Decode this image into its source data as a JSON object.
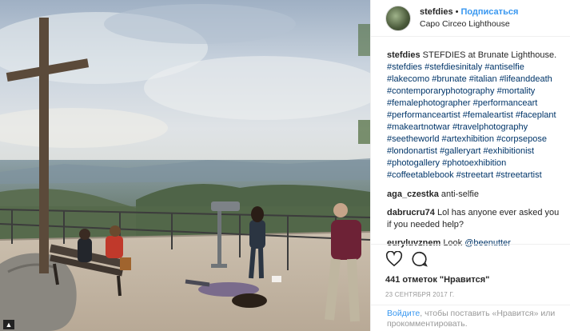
{
  "post": {
    "username": "stefdies",
    "separator": "•",
    "follow_label": "Подписаться",
    "location": "Capo Circeo Lighthouse"
  },
  "caption": {
    "username": "stefdies",
    "text": "STEFDIES at Brunate Lighthouse.",
    "hashtags": [
      "#stefdies",
      "#stefdiesinitaly",
      "#antiselfie",
      "#lakecomo",
      "#brunate",
      "#italian",
      "#lifeanddeath",
      "#contemporaryphotography",
      "#mortality",
      "#femalephotographer",
      "#performanceart",
      "#performanceartist",
      "#femaleartist",
      "#faceplant",
      "#makeartnotwar",
      "#travelphotography",
      "#seetheworld",
      "#artexhibition",
      "#corpsepose",
      "#londonartist",
      "#galleryart",
      "#exhibitionist",
      "#photogallery",
      "#photoexhibition",
      "#coffeetablebook",
      "#streetart",
      "#streetartist"
    ]
  },
  "comments": [
    {
      "user": "aga_czestka",
      "text": "anti-selfie"
    },
    {
      "user": "dabrucru74",
      "text": "Lol has anyone ever asked you if you needed help?"
    },
    {
      "user": "euryluvznem",
      "text": "Look",
      "mention": "@beenutter"
    }
  ],
  "actions": {
    "like_icon": "heart-icon",
    "comment_icon": "comment-icon",
    "likes_text": "441 отметок \"Нравится\"",
    "date": "23 сентября 2017 г."
  },
  "login_prompt": {
    "link": "Войдите",
    "text": ", чтобы поставить «Нравится» или прокомментировать."
  },
  "colors": {
    "accent": "#3897f0",
    "hashtag": "#003569",
    "border": "#efefef"
  }
}
